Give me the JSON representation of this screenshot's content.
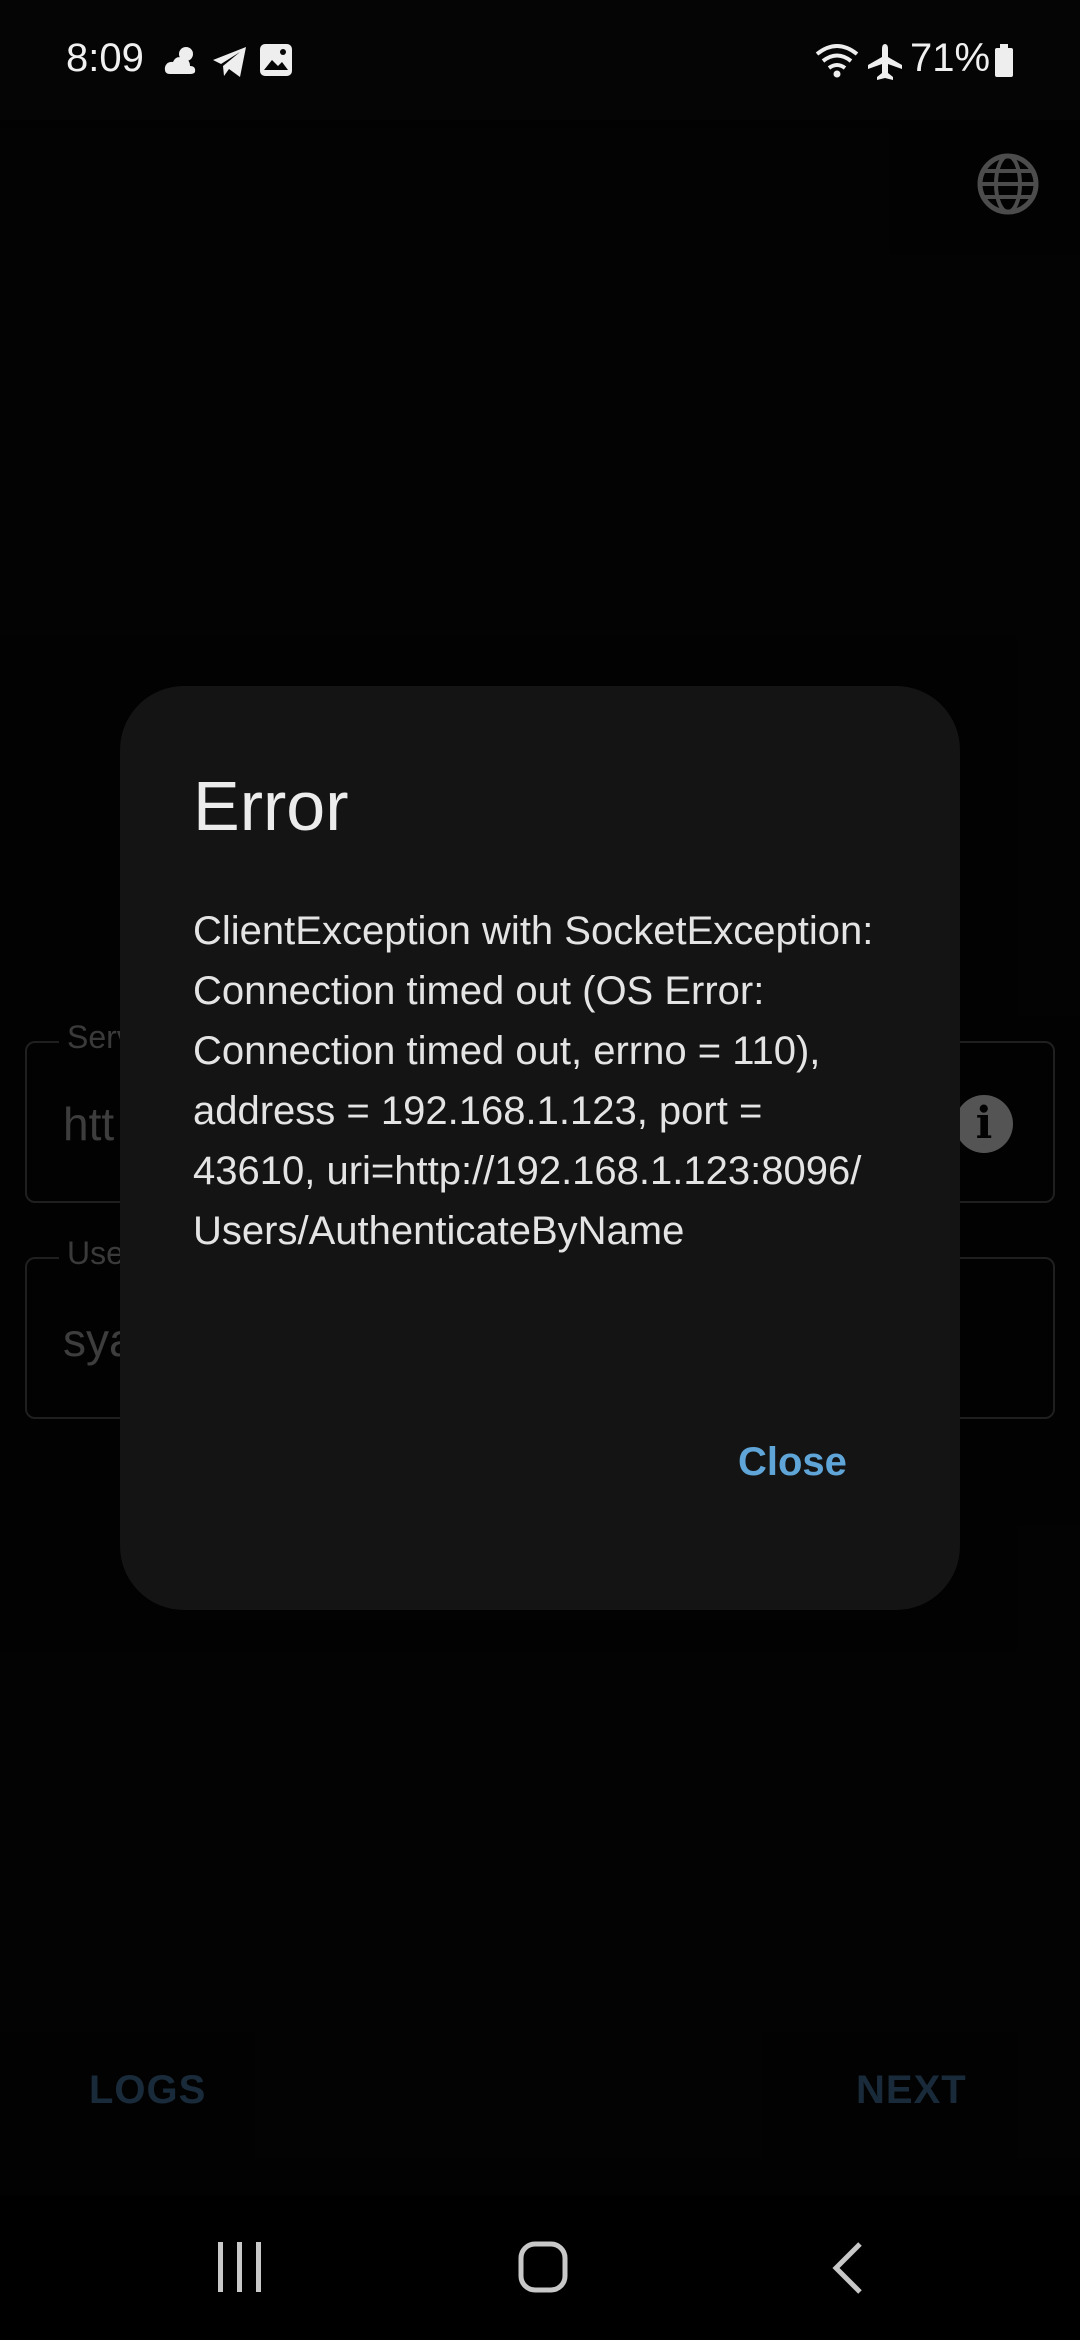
{
  "status_bar": {
    "time": "8:09",
    "battery_percent": "71%",
    "icons": [
      "weather-cloud-icon",
      "telegram-icon",
      "image-icon",
      "wifi-icon",
      "airplane-icon",
      "battery-icon"
    ]
  },
  "header": {
    "language_icon": "globe-icon"
  },
  "form": {
    "server_label": "Serv",
    "server_value": "htt",
    "username_label": "Use",
    "username_value": "sya"
  },
  "dialog": {
    "title": "Error",
    "message": "ClientException with SocketException: Connection timed out (OS Error: Connection timed out, errno = 110), address = 192.168.1.123, port = 43610, uri=http://192.168.1.123:8096/ Users/AuthenticateByName",
    "close_label": "Close"
  },
  "footer": {
    "logs_label": "LOGS",
    "next_label": "NEXT"
  },
  "colors": {
    "accent": "#5fa5d8",
    "background": "#050505",
    "dialog": "#141414"
  }
}
